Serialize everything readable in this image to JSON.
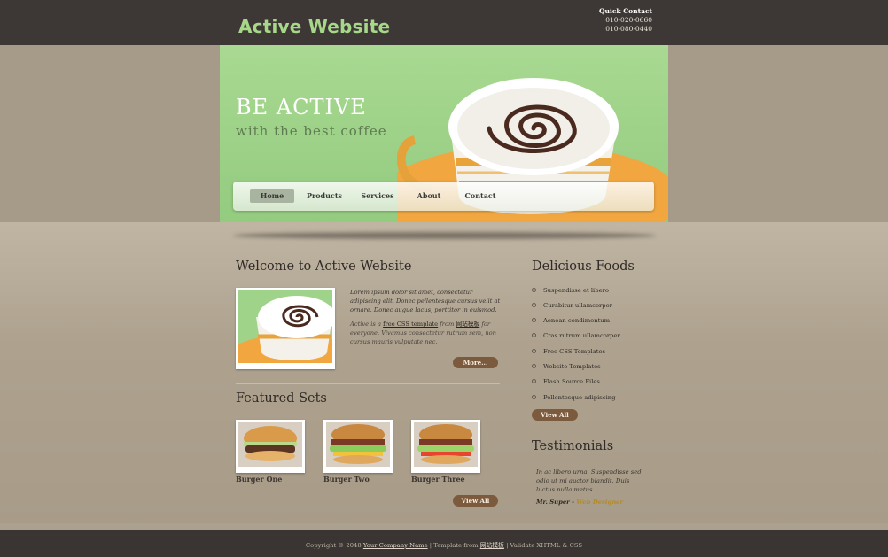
{
  "header": {
    "site_title": "Active Website",
    "quick_contact_title": "Quick Contact",
    "phone_1": "010-020-0660",
    "phone_2": "010-080-0440"
  },
  "banner": {
    "headline": "BE ACTIVE",
    "subheadline": "with the best coffee"
  },
  "nav": {
    "items": [
      "Home",
      "Products",
      "Services",
      "About",
      "Contact"
    ],
    "active": "Home"
  },
  "welcome": {
    "title": "Welcome to Active Website",
    "paragraph_1": "Lorem ipsum dolor sit amet, consectetur adipiscing elit. Donec pellentesque cursus velit at ornare. Donec augue lacus, porttitor in euismod.",
    "p2_prefix": "Active is a",
    "p2_link_1": "free CSS template",
    "p2_mid": "from",
    "p2_link_2": "网站模板",
    "p2_suffix": "for everyone. Vivamus consectetur rutrum sem, non cursus mauris vulputate nec.",
    "more_button": "More..."
  },
  "featured": {
    "title": "Featured Sets",
    "items": [
      "Burger One",
      "Burger Two",
      "Burger Three"
    ],
    "view_all": "View All"
  },
  "foods": {
    "title": "Delicious Foods",
    "items": [
      "Suspendisse et libero",
      "Curabitur ullamcorper",
      "Aenean condimentum",
      "Cras rutrum ullamcorper",
      "Free CSS Templates",
      "Website Templates",
      "Flash Source Files",
      "Pellentesque adipiscing"
    ],
    "view_all": "View All"
  },
  "testimonials": {
    "title": "Testimonials",
    "quote": "In ac libero urna. Suspendisse sed odio ut mi auctor blandit. Duis luctus nulla metus",
    "author": "Mr. Super",
    "separator": " - ",
    "role": "Web Designer"
  },
  "footer": {
    "copyright": "Copyright © 2048",
    "company": "Your Company Name",
    "sep": " | ",
    "template_prefix": "Template from",
    "template_link": "网站模板",
    "validate": "Validate XHTML & CSS"
  },
  "colors": {
    "header_bg": "#3d3835",
    "title_green": "#a7d88a",
    "banner_green": "#a9d992",
    "page_bg": "#aca08e",
    "button_brown": "#7c5a3e",
    "role_gold": "#b58a25"
  }
}
